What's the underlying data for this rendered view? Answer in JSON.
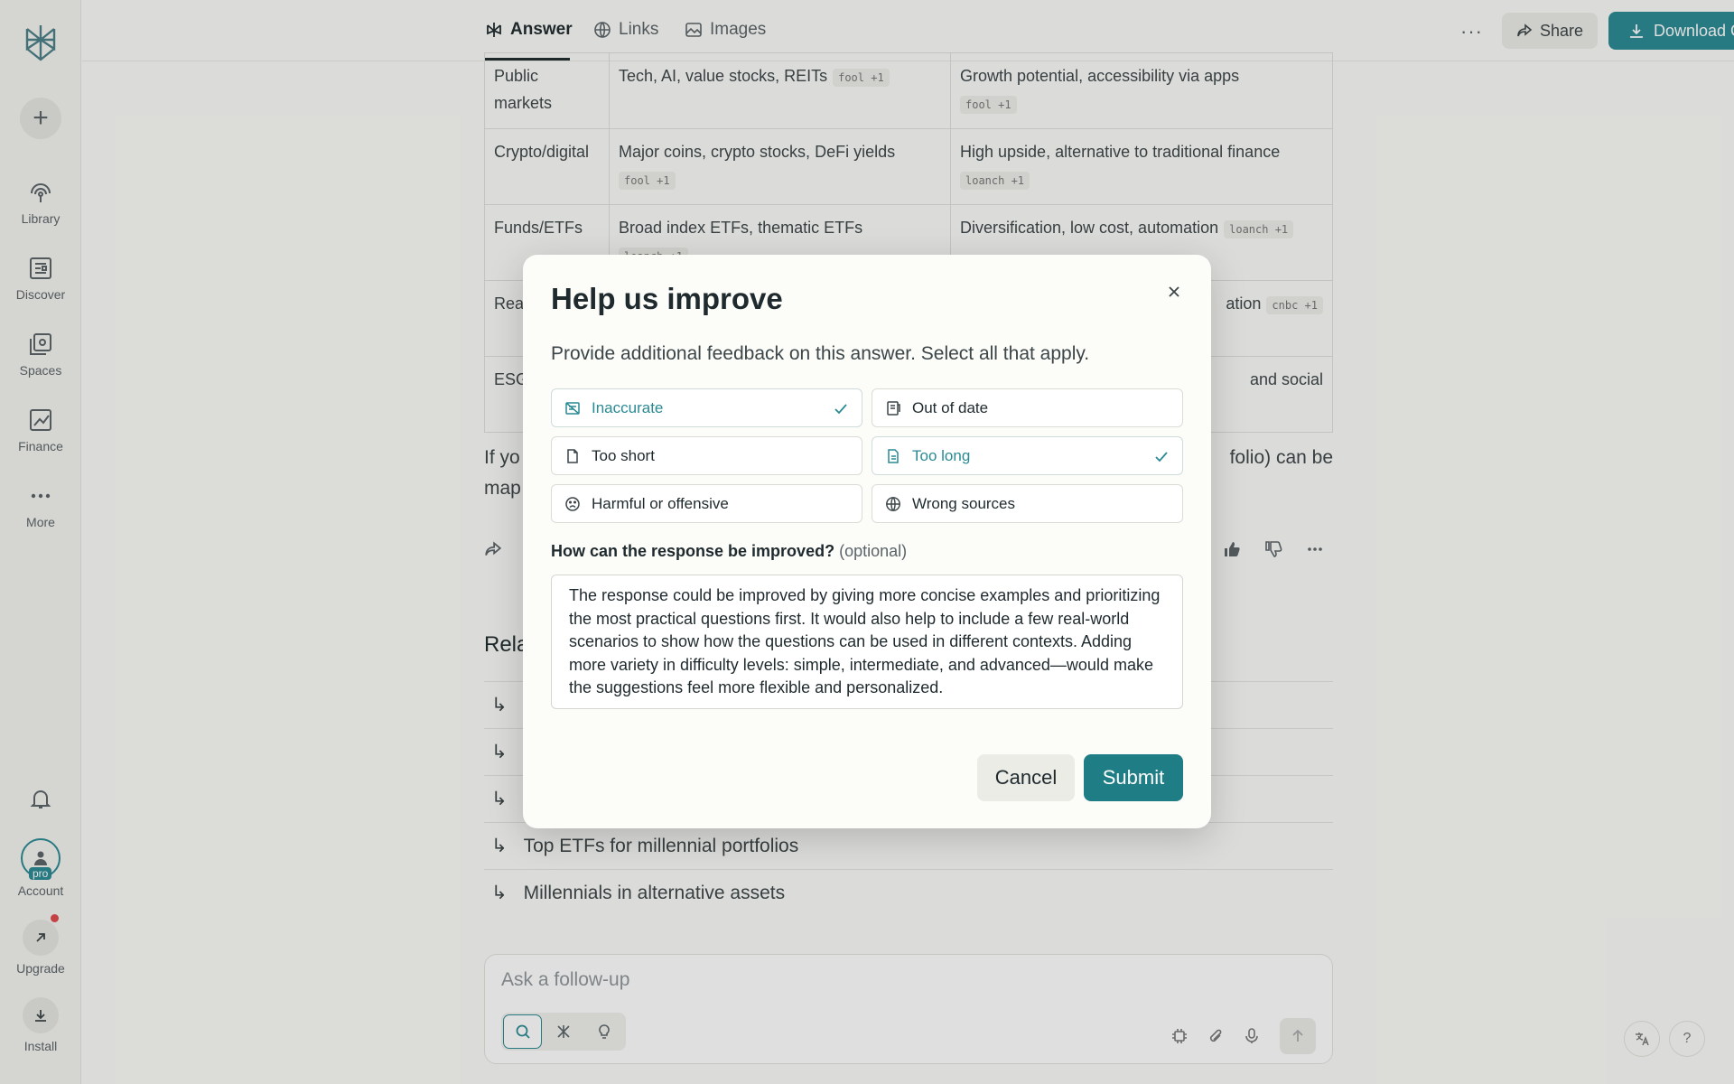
{
  "sidebar": {
    "nav": [
      {
        "label": "Library",
        "icon": "library-icon"
      },
      {
        "label": "Discover",
        "icon": "discover-icon"
      },
      {
        "label": "Spaces",
        "icon": "spaces-icon"
      },
      {
        "label": "Finance",
        "icon": "finance-icon"
      },
      {
        "label": "More",
        "icon": "more-icon"
      }
    ],
    "account_label": "Account",
    "pro_badge": "pro",
    "upgrade_label": "Upgrade",
    "install_label": "Install"
  },
  "topbar": {
    "tabs": [
      {
        "label": "Answer",
        "active": true
      },
      {
        "label": "Links",
        "active": false
      },
      {
        "label": "Images",
        "active": false
      }
    ],
    "share_label": "Share",
    "download_label": "Download Comet",
    "accent": "#2a8a93"
  },
  "table": {
    "rows": [
      {
        "c1": "Public markets",
        "c2": "Tech, AI, value stocks, REITs",
        "c2_cite": "fool +1",
        "c3": "Growth potential, accessibility via apps",
        "c3_cite": "fool +1"
      },
      {
        "c1": "Crypto/digital",
        "c2": "Major coins, crypto stocks, DeFi yields",
        "c2_cite": "fool +1",
        "c3": "High upside, alternative to traditional finance",
        "c3_cite": "loanch +1"
      },
      {
        "c1": "Funds/ETFs",
        "c2": "Broad index ETFs, thematic ETFs",
        "c2_cite": "loanch +1",
        "c3": "Diversification, low cost, automation",
        "c3_cite": "loanch +1"
      },
      {
        "c1": "Rea alts",
        "c2": "",
        "c2_cite": "",
        "c3": "ation",
        "c3_cite": "cnbc +1"
      },
      {
        "c1": "ESG",
        "c2": "",
        "c2_cite": "",
        "c3": "and social",
        "c3_cite": ""
      }
    ]
  },
  "paragraph": {
    "left": "If yo",
    "left2": "map",
    "right": "folio) can be"
  },
  "related": {
    "title": "Rela",
    "items": [
      "",
      "",
      "",
      "Top ETFs for millennial portfolios",
      "Millennials in alternative assets"
    ]
  },
  "followup": {
    "placeholder": "Ask a follow-up"
  },
  "modal": {
    "title": "Help us improve",
    "subtitle": "Provide additional feedback on this answer. Select all that apply.",
    "options": [
      {
        "label": "Inaccurate",
        "icon": "inaccurate-icon",
        "selected": true
      },
      {
        "label": "Out of date",
        "icon": "calendar-icon",
        "selected": false
      },
      {
        "label": "Too short",
        "icon": "document-icon",
        "selected": false
      },
      {
        "label": "Too long",
        "icon": "document-lines-icon",
        "selected": true
      },
      {
        "label": "Harmful or offensive",
        "icon": "frown-icon",
        "selected": false
      },
      {
        "label": "Wrong sources",
        "icon": "globe-icon",
        "selected": false
      }
    ],
    "question": "How can the response be improved?",
    "optional": "(optional)",
    "feedback_text": "The response could be improved by giving more concise examples and prioritizing the most practical questions first. It would also help to include a few real-world scenarios to show how the questions can be used in different contexts. Adding more variety in difficulty levels: simple, intermediate, and advanced—would make the suggestions feel more flexible and personalized.",
    "cancel_label": "Cancel",
    "submit_label": "Submit"
  }
}
